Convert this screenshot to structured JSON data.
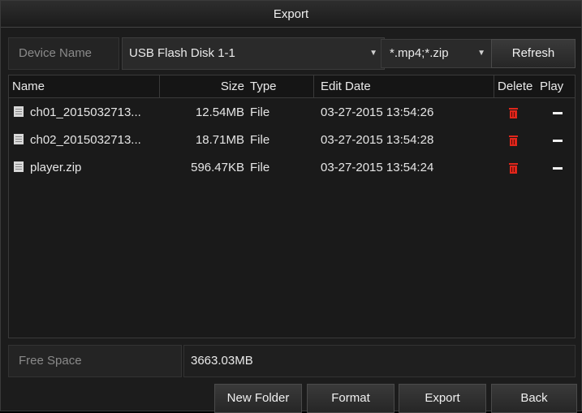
{
  "window": {
    "title": "Export"
  },
  "device": {
    "label": "Device Name",
    "selected": "USB Flash Disk 1-1",
    "ext_filter": "*.mp4;*.zip",
    "refresh_label": "Refresh"
  },
  "table": {
    "columns": {
      "name": "Name",
      "size": "Size",
      "type": "Type",
      "date": "Edit Date",
      "delete": "Delete",
      "play": "Play"
    },
    "rows": [
      {
        "name": "ch01_2015032713...",
        "size": "12.54MB",
        "type": "File",
        "date": "03-27-2015 13:54:26",
        "delete_icon": "trash-icon",
        "play_icon": "dash-icon"
      },
      {
        "name": "ch02_2015032713...",
        "size": "18.71MB",
        "type": "File",
        "date": "03-27-2015 13:54:28",
        "delete_icon": "trash-icon",
        "play_icon": "dash-icon"
      },
      {
        "name": "player.zip",
        "size": "596.47KB",
        "type": "File",
        "date": "03-27-2015 13:54:24",
        "delete_icon": "trash-icon",
        "play_icon": "dash-icon"
      }
    ]
  },
  "free_space": {
    "label": "Free Space",
    "value": "3663.03MB"
  },
  "buttons": {
    "new_folder": "New Folder",
    "format": "Format",
    "export": "Export",
    "back": "Back"
  },
  "colors": {
    "delete_icon": "#e0261b",
    "background": "#1c1c1c"
  }
}
